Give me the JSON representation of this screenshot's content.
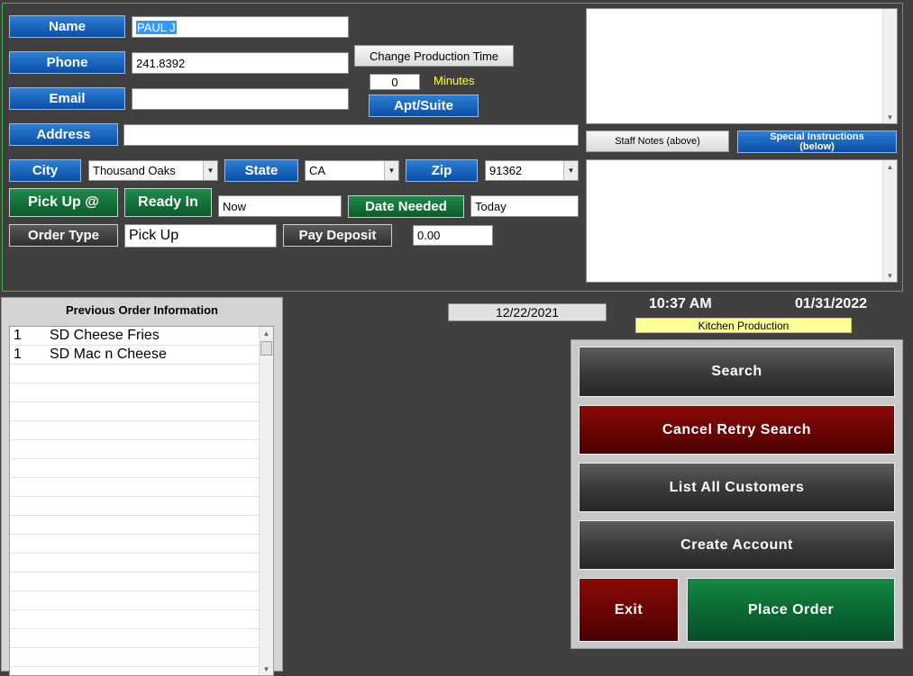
{
  "customer": {
    "name_label": "Name",
    "name_value": "PAUL J",
    "phone_label": "Phone",
    "phone_value": "241.8392",
    "email_label": "Email",
    "email_value": "",
    "address_label": "Address",
    "address_value": "",
    "city_label": "City",
    "city_value": "Thousand Oaks",
    "state_label": "State",
    "state_value": "CA",
    "zip_label": "Zip",
    "zip_value": "91362"
  },
  "production": {
    "change_time_label": "Change Production Time",
    "minutes_value": "0",
    "minutes_label": "Minutes",
    "apt_suite_label": "Apt/Suite"
  },
  "order": {
    "pickup_label": "Pick Up @",
    "ready_in_label": "Ready In",
    "ready_in_value": "Now",
    "date_needed_label": "Date Needed",
    "date_needed_value": "Today",
    "order_type_label": "Order Type",
    "order_type_value": "Pick Up",
    "pay_deposit_label": "Pay Deposit",
    "deposit_value": "0.00"
  },
  "notes": {
    "staff_notes_label": "Staff Notes (above)",
    "special_instructions_label_1": "Special Instructions",
    "special_instructions_label_2": "(below)"
  },
  "status": {
    "date_field": "12/22/2021",
    "time": "10:37 AM",
    "date": "01/31/2022",
    "kitchen_label": "Kitchen Production"
  },
  "previous_orders": {
    "title": "Previous Order Information",
    "items": [
      {
        "qty": "1",
        "name": "SD Cheese Fries"
      },
      {
        "qty": "1",
        "name": "SD Mac n Cheese"
      }
    ]
  },
  "actions": {
    "search": "Search",
    "cancel_retry": "Cancel Retry Search",
    "list_all": "List All Customers",
    "create_account": "Create Account",
    "exit": "Exit",
    "place_order": "Place Order"
  },
  "colors": {
    "background": "#404040",
    "panel_border": "#3fb84a",
    "blue_button": "#0b4fa6",
    "green_button": "#0b5a2c",
    "red_button": "#6d0404",
    "minutes_text": "#ffff33",
    "kitchen_bg": "#ffff99"
  }
}
